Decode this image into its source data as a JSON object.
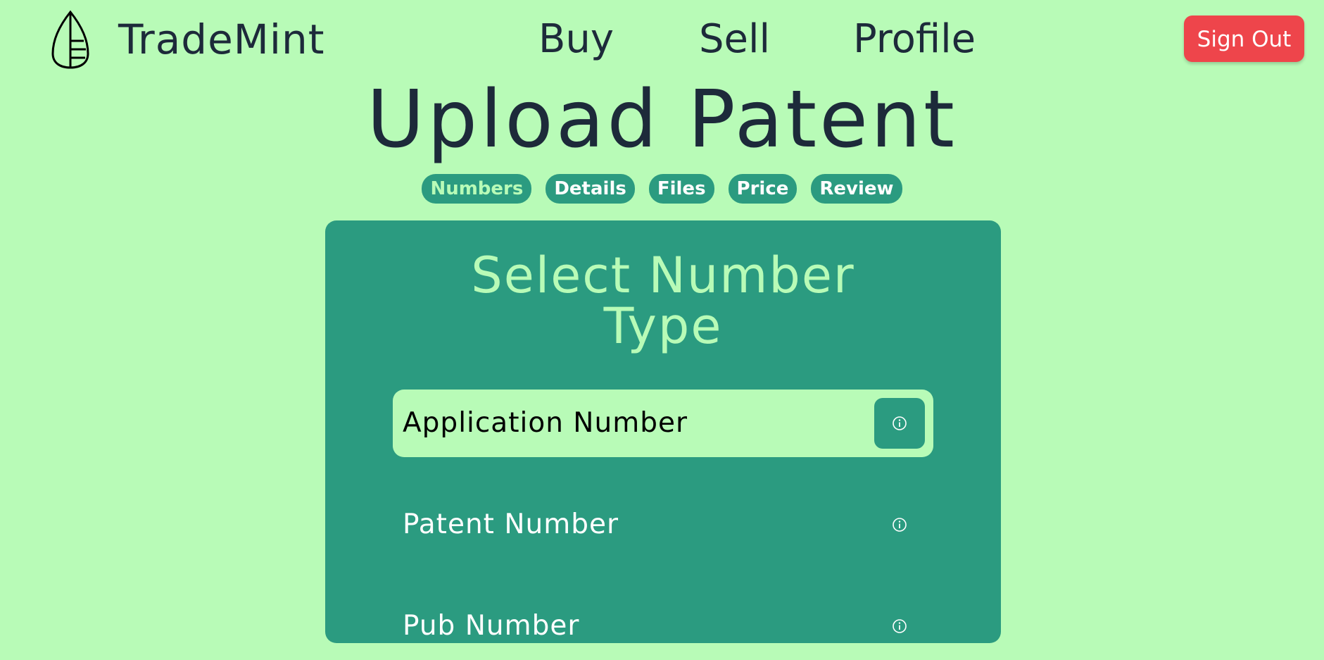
{
  "header": {
    "brand": "TradeMint",
    "nav": {
      "buy": "Buy",
      "sell": "Sell",
      "profile": "Profile"
    },
    "sign_out": "Sign Out"
  },
  "page": {
    "title": "Upload Patent"
  },
  "steps": [
    {
      "label": "Numbers",
      "active": true
    },
    {
      "label": "Details",
      "active": false
    },
    {
      "label": "Files",
      "active": false
    },
    {
      "label": "Price",
      "active": false
    },
    {
      "label": "Review",
      "active": false
    }
  ],
  "card": {
    "title_line1": "Select Number",
    "title_line2": "Type",
    "options": [
      {
        "label": "Application Number",
        "selected": true,
        "icon": "info-icon"
      },
      {
        "label": "Patent Number",
        "selected": false,
        "icon": "info-icon"
      },
      {
        "label": "Pub Number",
        "selected": false,
        "icon": "info-icon"
      }
    ]
  },
  "colors": {
    "background": "#b8fbb7",
    "accent": "#2b9b80",
    "text_dark": "#1d2a3a",
    "sign_out": "#ee454b"
  }
}
